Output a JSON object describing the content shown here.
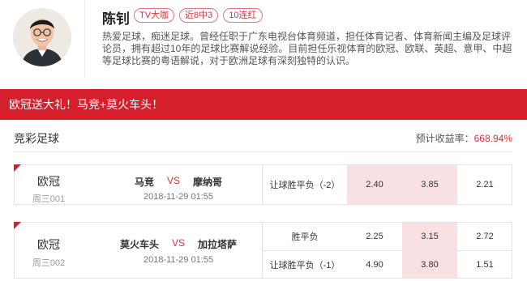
{
  "profile": {
    "name": "陈钊",
    "badges": [
      "TV大咖",
      "近8中3",
      "10连红"
    ],
    "bio": "热爱足球，痴迷足球。曾经任职于广东电视台体育频道，担任体育记者、体育新闻主编及足球评论员，拥有超过10年的足球比赛解说经验。目前担任乐视体育的欧冠、欧联、英超、意甲、中超等足球比赛的粤语解说，对于欧洲足球有深刻独特的认识。"
  },
  "promo": {
    "title": "欧冠送大礼！马竞+莫火车头！"
  },
  "section": {
    "title": "竞彩足球",
    "roi_label": "预计收益率：",
    "roi_value": "668.94%"
  },
  "matches": [
    {
      "league": "欧冠",
      "match_no": "周三001",
      "home": "马竞",
      "vs": "VS",
      "away": "摩纳哥",
      "time": "2018-11-29 01:55",
      "rows": [
        {
          "play": "让球胜平负（-2）",
          "odds": [
            "2.40",
            "3.85",
            "2.21"
          ],
          "selected": [
            true,
            true,
            false
          ]
        }
      ]
    },
    {
      "league": "欧冠",
      "match_no": "周三002",
      "home": "莫火车头",
      "vs": "VS",
      "away": "加拉塔萨",
      "time": "2018-11-29 01:55",
      "rows": [
        {
          "play": "胜平负",
          "odds": [
            "2.25",
            "3.15",
            "2.72"
          ],
          "selected": [
            false,
            true,
            false
          ]
        },
        {
          "play": "让球胜平负（-1）",
          "odds": [
            "4.90",
            "3.80",
            "1.51"
          ],
          "selected": [
            false,
            true,
            false
          ]
        }
      ]
    }
  ],
  "colors": {
    "brand_red": "#d51f2d",
    "selected_bg": "#f9e1e3",
    "accent_text": "#d6323a"
  }
}
